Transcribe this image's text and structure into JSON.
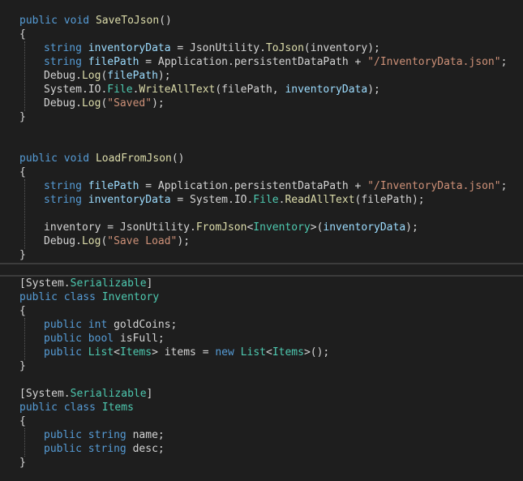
{
  "editor": {
    "top_pane": {
      "method_save": {
        "signature": [
          "public",
          "void",
          "SaveToJson",
          "()"
        ],
        "open_brace": "{",
        "lines": [
          [
            "string",
            "inventoryData",
            " = JsonUtility.",
            "ToJson",
            "(inventory);"
          ],
          [
            "string",
            "filePath",
            " = Application.persistentDataPath + ",
            "\"/InventoryData.json\"",
            ";"
          ],
          [
            "Debug.",
            "Log",
            "(",
            "filePath",
            ");"
          ],
          [
            "System.IO.",
            "File",
            ".",
            "WriteAllText",
            "(filePath, ",
            "inventoryData",
            ");"
          ],
          [
            "Debug.",
            "Log",
            "(",
            "\"Saved\"",
            ");"
          ]
        ],
        "close_brace": "}"
      },
      "method_load": {
        "signature": [
          "public",
          "void",
          "LoadFromJson",
          "()"
        ],
        "open_brace": "{",
        "lines": [
          [
            "string",
            "filePath",
            " = Application.persistentDataPath + ",
            "\"/InventoryData.json\"",
            ";"
          ],
          [
            "string",
            "inventoryData",
            " = System.IO.",
            "File",
            ".",
            "ReadAllText",
            "(filePath);"
          ],
          [
            "inventory = JsonUtility.",
            "FromJson",
            "<",
            "Inventory",
            ">(",
            "inventoryData",
            ");"
          ],
          [
            "Debug.",
            "Log",
            "(",
            "\"Save Load\"",
            ");"
          ]
        ],
        "close_brace": "}"
      }
    },
    "bottom_pane": {
      "class_inventory": {
        "attribute": [
          "[System.",
          "Serializable",
          "]"
        ],
        "declaration": [
          "public",
          "class",
          "Inventory"
        ],
        "open_brace": "{",
        "fields": [
          [
            "public",
            "int",
            "goldCoins;"
          ],
          [
            "public",
            "bool",
            "isFull;"
          ],
          [
            "public",
            "List",
            "<",
            "Items",
            "> items = ",
            "new",
            "List",
            "<",
            "Items",
            ">();"
          ]
        ],
        "close_brace": "}"
      },
      "class_items": {
        "attribute": [
          "[System.",
          "Serializable",
          "]"
        ],
        "declaration": [
          "public",
          "class",
          "Items"
        ],
        "open_brace": "{",
        "fields": [
          [
            "public",
            "string",
            "name;"
          ],
          [
            "public",
            "string",
            "desc;"
          ]
        ],
        "close_brace": "}"
      }
    },
    "colors": {
      "background": "#1e1e1e",
      "keyword": "#569cd6",
      "method": "#dcdcaa",
      "variable": "#9cdcfe",
      "type": "#4ec9b0",
      "string": "#ce9178",
      "plain": "#d4d4d4"
    }
  }
}
